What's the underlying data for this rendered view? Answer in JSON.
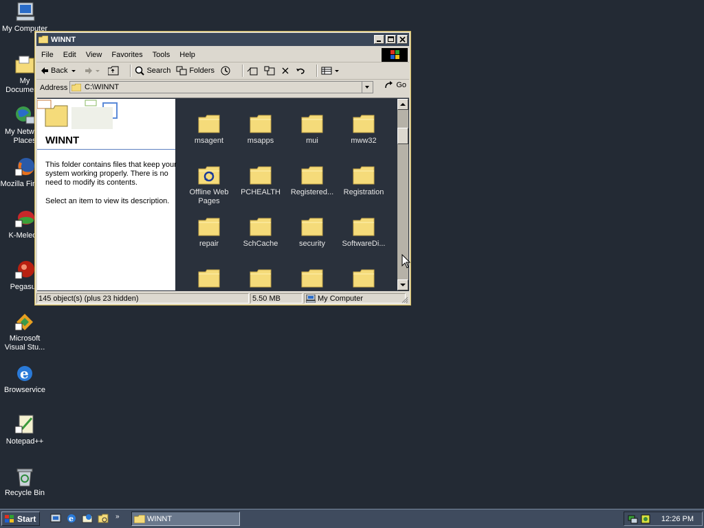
{
  "desktop": {
    "icons": [
      {
        "label": "My Computer"
      },
      {
        "label": "My Documents"
      },
      {
        "label": "My Network\nPlaces"
      },
      {
        "label": "Mozilla Firefox"
      },
      {
        "label": "K-Meleon"
      },
      {
        "label": "Pegasus"
      },
      {
        "label": "Microsoft\nVisual Stu..."
      },
      {
        "label": "Browservice"
      },
      {
        "label": "Notepad++"
      },
      {
        "label": "Recycle Bin"
      }
    ]
  },
  "window": {
    "title": "WINNT",
    "menu": [
      "File",
      "Edit",
      "View",
      "Favorites",
      "Tools",
      "Help"
    ],
    "toolbar": {
      "back": "Back",
      "search": "Search",
      "folders": "Folders"
    },
    "address": {
      "label": "Address",
      "value": "C:\\WINNT",
      "go": "Go"
    },
    "left_pane": {
      "title": "WINNT",
      "description": "This folder contains files that keep your system working properly. There is no need to modify its contents.",
      "hint": "Select an item to view its description."
    },
    "files": [
      {
        "name": "msagent"
      },
      {
        "name": "msapps"
      },
      {
        "name": "mui"
      },
      {
        "name": "mww32"
      },
      {
        "name": "Offline Web Pages"
      },
      {
        "name": "PCHEALTH"
      },
      {
        "name": "Registered..."
      },
      {
        "name": "Registration"
      },
      {
        "name": "repair"
      },
      {
        "name": "SchCache"
      },
      {
        "name": "security"
      },
      {
        "name": "SoftwareDi..."
      },
      {
        "name": ""
      },
      {
        "name": ""
      },
      {
        "name": ""
      },
      {
        "name": ""
      }
    ],
    "status": {
      "objects": "145 object(s) (plus 23 hidden)",
      "size": "5.50 MB",
      "location": "My Computer"
    }
  },
  "taskbar": {
    "start": "Start",
    "task": "WINNT",
    "clock": "12:26 PM"
  },
  "colors": {
    "desktop": "#232a34",
    "titlebar": "#3a4658",
    "folder": "#f5db7a"
  }
}
